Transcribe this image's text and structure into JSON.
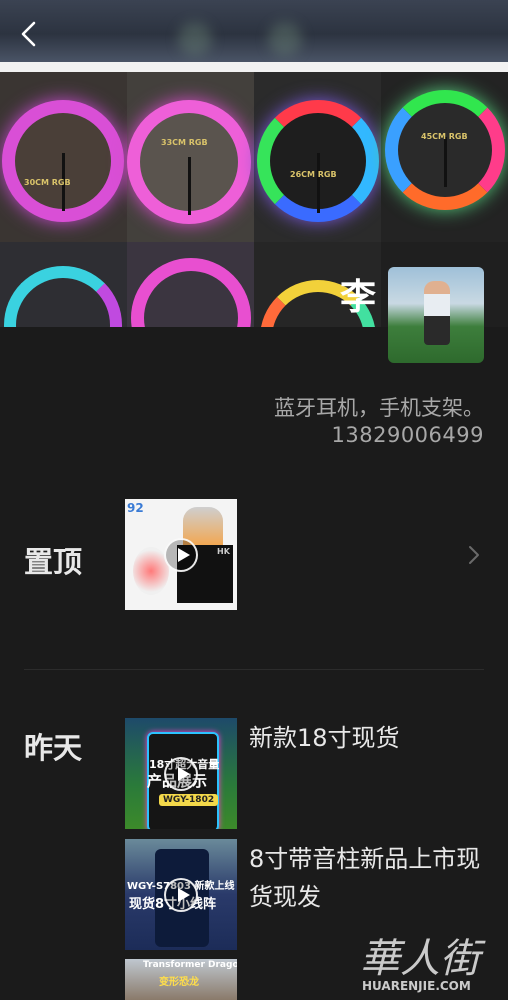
{
  "header": {
    "back_icon": "back-arrow-icon"
  },
  "cover": {
    "ring_labels": [
      "30CM RGB",
      "33CM RGB",
      "26CM RGB",
      "45CM RGB"
    ]
  },
  "profile": {
    "name": "李",
    "bio": "蓝牙耳机，手机支架。",
    "phone": "13829006499"
  },
  "sections": {
    "pinned": {
      "label": "置顶",
      "thumb_badge": "92",
      "thumb_brand": "HK"
    },
    "yesterday": {
      "label": "昨天",
      "posts": [
        {
          "title": "新款18寸现货",
          "overlay_line1": "18寸超大音量",
          "overlay_line2": "产品展示",
          "overlay_tag": "WGY-1802"
        },
        {
          "title": "8寸带音柱新品上市现货现发",
          "overlay_line1": "WGY-S7803 新款上线",
          "overlay_line2": "现货8寸小线阵"
        },
        {
          "title": "",
          "overlay_line1": "Transformer Dragon",
          "overlay_line2": "变形恐龙"
        }
      ]
    }
  },
  "watermark": {
    "text": "華人街",
    "sub": "HUARENJIE.COM"
  },
  "colors": {
    "background": "#1b1b1b",
    "text_secondary": "#a8a8a8"
  }
}
